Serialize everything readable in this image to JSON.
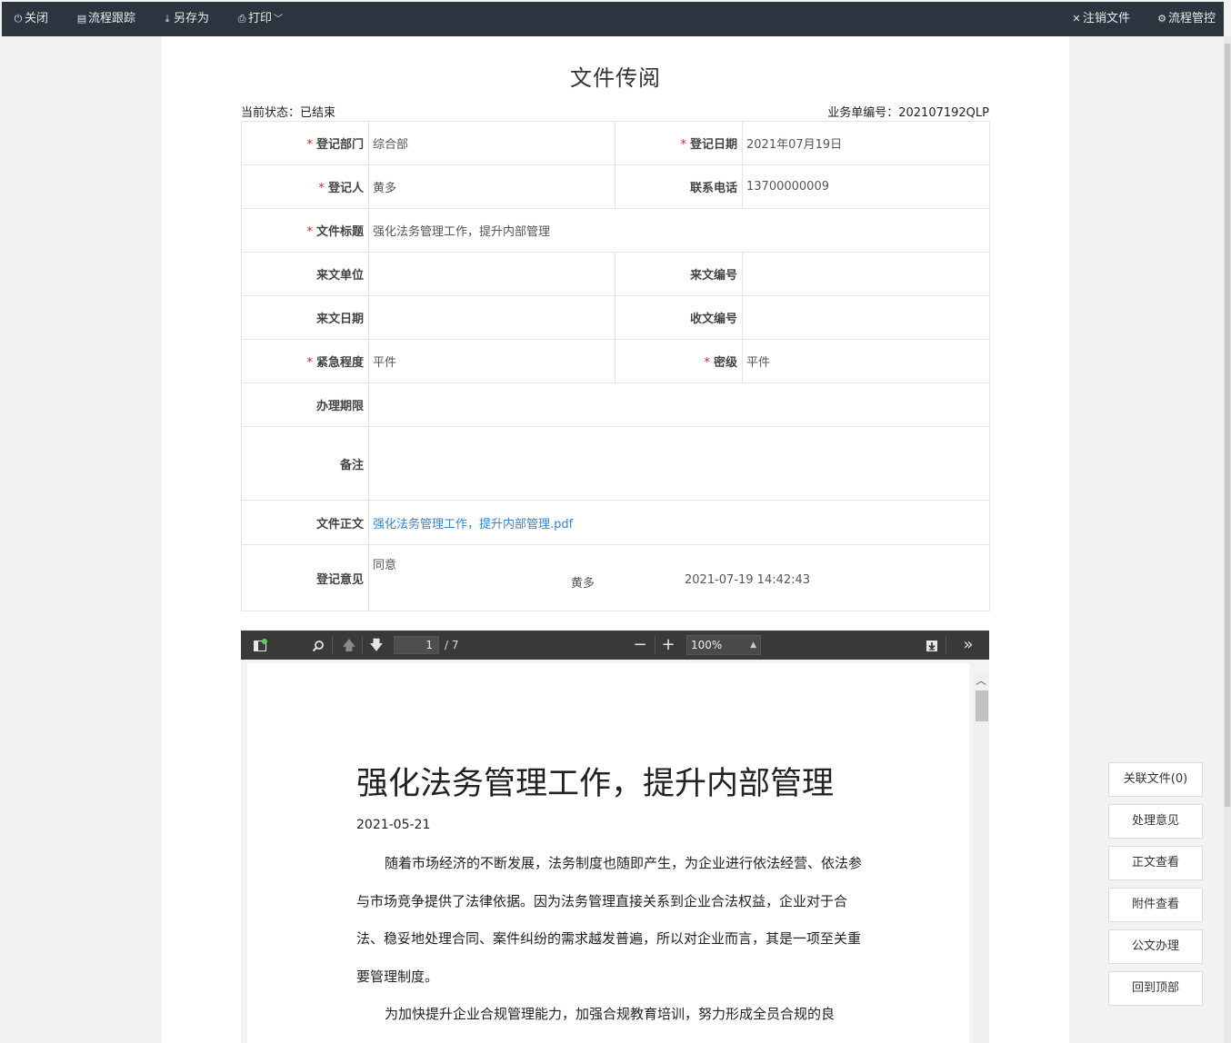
{
  "toolbar": {
    "close": "关闭",
    "track": "流程跟踪",
    "saveas": "另存为",
    "print": "打印",
    "cancel_doc": "注销文件",
    "flow_control": "流程管控"
  },
  "doc": {
    "title": "文件传阅",
    "status_label": "当前状态：",
    "status_value": "已结束",
    "biz_no_label": "业务单编号：",
    "biz_no_value": "202107192QLP"
  },
  "form": {
    "required_mark": "*",
    "dept_label": "登记部门",
    "dept_value": "综合部",
    "date_label": "登记日期",
    "date_value": "2021年07月19日",
    "person_label": "登记人",
    "person_value": "黄多",
    "phone_label": "联系电话",
    "phone_value": "13700000009",
    "subject_label": "文件标题",
    "subject_value": "强化法务管理工作，提升内部管理",
    "source_unit_label": "来文单位",
    "source_unit_value": "",
    "source_no_label": "来文编号",
    "source_no_value": "",
    "source_date_label": "来文日期",
    "source_date_value": "",
    "receive_no_label": "收文编号",
    "receive_no_value": "",
    "urgency_label": "紧急程度",
    "urgency_value": "平件",
    "secret_label": "密级",
    "secret_value": "平件",
    "deadline_label": "办理期限",
    "deadline_value": "",
    "remark_label": "备注",
    "remark_value": "",
    "body_label": "文件正文",
    "body_file": "强化法务管理工作，提升内部管理.pdf",
    "opinion_label": "登记意见",
    "opinion_text": "同意",
    "opinion_user": "黄多",
    "opinion_time": "2021-07-19 14:42:43"
  },
  "pdf": {
    "current_page": "1",
    "total_pages": "/ 7",
    "zoom": "100%",
    "heading": "强化法务管理工作，提升内部管理",
    "date": "2021-05-21",
    "para1": "随着市场经济的不断发展，法务制度也随即产生，为企业进行依法经营、依法参与市场竞争提供了法律依据。因为法务管理直接关系到企业合法权益，企业对于合法、稳妥地处理合同、案件纠纷的需求越发普遍，所以对企业而言，其是一项至关重要管理制度。",
    "para2": "为加快提升企业合规管理能力，加强合规教育培训，努力形成全员合规的良"
  },
  "side": {
    "related": "关联文件(0)",
    "opinions": "处理意见",
    "view_body": "正文查看",
    "view_attach": "附件查看",
    "handle": "公文办理",
    "to_top": "回到顶部"
  }
}
